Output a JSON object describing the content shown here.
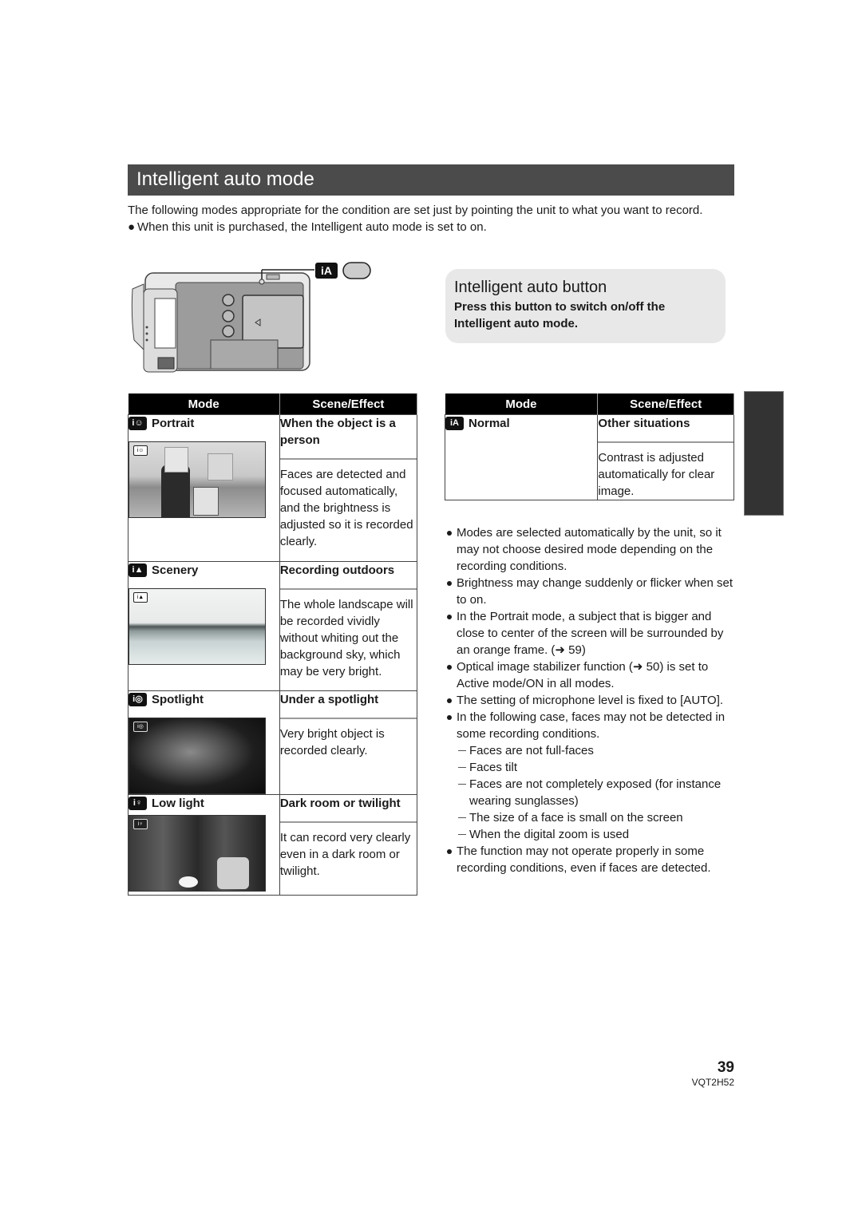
{
  "header": {
    "title": "Intelligent auto mode"
  },
  "intro": {
    "paragraph": "The following modes appropriate for the condition are set just by pointing the unit to what you want to record.",
    "bullet": "When this unit is purchased, the Intelligent auto mode is set to on."
  },
  "illustration": {
    "button_icon_text": "iA",
    "icon": "camcorder-rear-illustration"
  },
  "callout": {
    "heading": "Intelligent auto button",
    "body": "Press this button to switch on/off the Intelligent auto mode."
  },
  "left_table": {
    "headers": [
      "Mode",
      "Scene/Effect"
    ],
    "rows": [
      {
        "icon_text": "i☺",
        "mode": "Portrait",
        "scene": "When the object is a person",
        "effect": "Faces are detected and focused automatically, and the brightness is adjusted so it is recorded clearly.",
        "photo": "portrait-sample-photo"
      },
      {
        "icon_text": "i▲",
        "mode": "Scenery",
        "scene": "Recording outdoors",
        "effect": "The whole landscape will be recorded vividly without whiting out the background sky, which may be very bright.",
        "photo": "scenery-sample-photo"
      },
      {
        "icon_text": "i◎",
        "mode": "Spotlight",
        "scene": "Under a spotlight",
        "effect": "Very bright object is recorded clearly.",
        "photo": "spotlight-sample-photo"
      },
      {
        "icon_text": "i♀",
        "mode": "Low light",
        "scene": "Dark room or twilight",
        "effect": "It can record very clearly even in a dark room or twilight.",
        "photo": "lowlight-sample-photo"
      }
    ]
  },
  "right_table": {
    "headers": [
      "Mode",
      "Scene/Effect"
    ],
    "rows": [
      {
        "icon_text": "iA",
        "mode": "Normal",
        "scene": "Other situations",
        "effect": "Contrast is adjusted automatically for clear image."
      }
    ]
  },
  "notes": {
    "items": [
      "Modes are selected automatically by the unit, so it may not choose desired mode depending on the recording conditions.",
      "Brightness may change suddenly or flicker when set to on.",
      "In the Portrait mode, a subject that is bigger and close to center of the screen will be surrounded by an orange frame. (➜ 59)",
      "Optical image stabilizer function (➜ 50) is set to Active mode/ON in all modes.",
      "The setting of microphone level is fixed to [AUTO].",
      "In the following case, faces may not be detected in some recording conditions."
    ],
    "subitems": [
      "Faces are not full-faces",
      "Faces tilt",
      "Faces are not completely exposed (for instance wearing sunglasses)",
      "The size of a face is small on the screen",
      "When the digital zoom is used"
    ],
    "last_item": "The function may not operate properly in some recording conditions, even if faces are detected."
  },
  "footer": {
    "page_number": "39",
    "doc_code": "VQT2H52"
  }
}
